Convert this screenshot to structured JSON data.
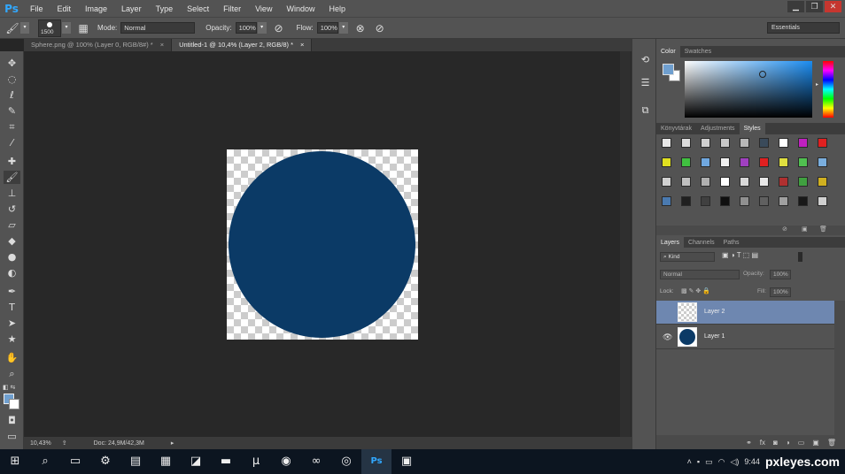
{
  "app": {
    "logo": "Ps"
  },
  "menu": [
    "File",
    "Edit",
    "Image",
    "Layer",
    "Type",
    "Select",
    "Filter",
    "View",
    "Window",
    "Help"
  ],
  "window_controls": {
    "minimize": "▁",
    "restore": "❐",
    "close": "✕"
  },
  "options": {
    "brush_size": "1500",
    "mode_label": "Mode:",
    "mode_value": "Normal",
    "opacity_label": "Opacity:",
    "opacity_value": "100%",
    "flow_label": "Flow:",
    "flow_value": "100%",
    "workspace": "Essentials"
  },
  "tabs": [
    {
      "label": "Sphere.png @ 100% (Layer 0, RGB/8#) *",
      "close": "×"
    },
    {
      "label": "Untitled-1 @ 10,4% (Layer 2, RGB/8) *",
      "close": "×"
    }
  ],
  "status": {
    "zoom": "10,43%",
    "doc": "Doc: 24,9M/42,3M"
  },
  "panels": {
    "color_tabs": [
      "Color",
      "Swatches"
    ],
    "styles_tabs": [
      "Könyvtárak",
      "Adjustments",
      "Styles"
    ],
    "layers_tabs": [
      "Layers",
      "Channels",
      "Paths"
    ],
    "filter_kind": "Kind",
    "blend_mode": "Normal",
    "opacity_label": "Opacity:",
    "opacity_value": "100%",
    "lock_label": "Lock:",
    "fill_label": "Fill:",
    "fill_value": "100%"
  },
  "layers": [
    {
      "name": "Layer 2",
      "selected": true,
      "visible": false
    },
    {
      "name": "Layer 1",
      "selected": false,
      "visible": true
    }
  ],
  "colors": {
    "foreground": "#6f9fcf",
    "background": "#ffffff",
    "sphere": "#0b3a66",
    "selection": "#6e87b0"
  },
  "tray": {
    "time": "9:44",
    "watermark": "pxleyes.com"
  }
}
